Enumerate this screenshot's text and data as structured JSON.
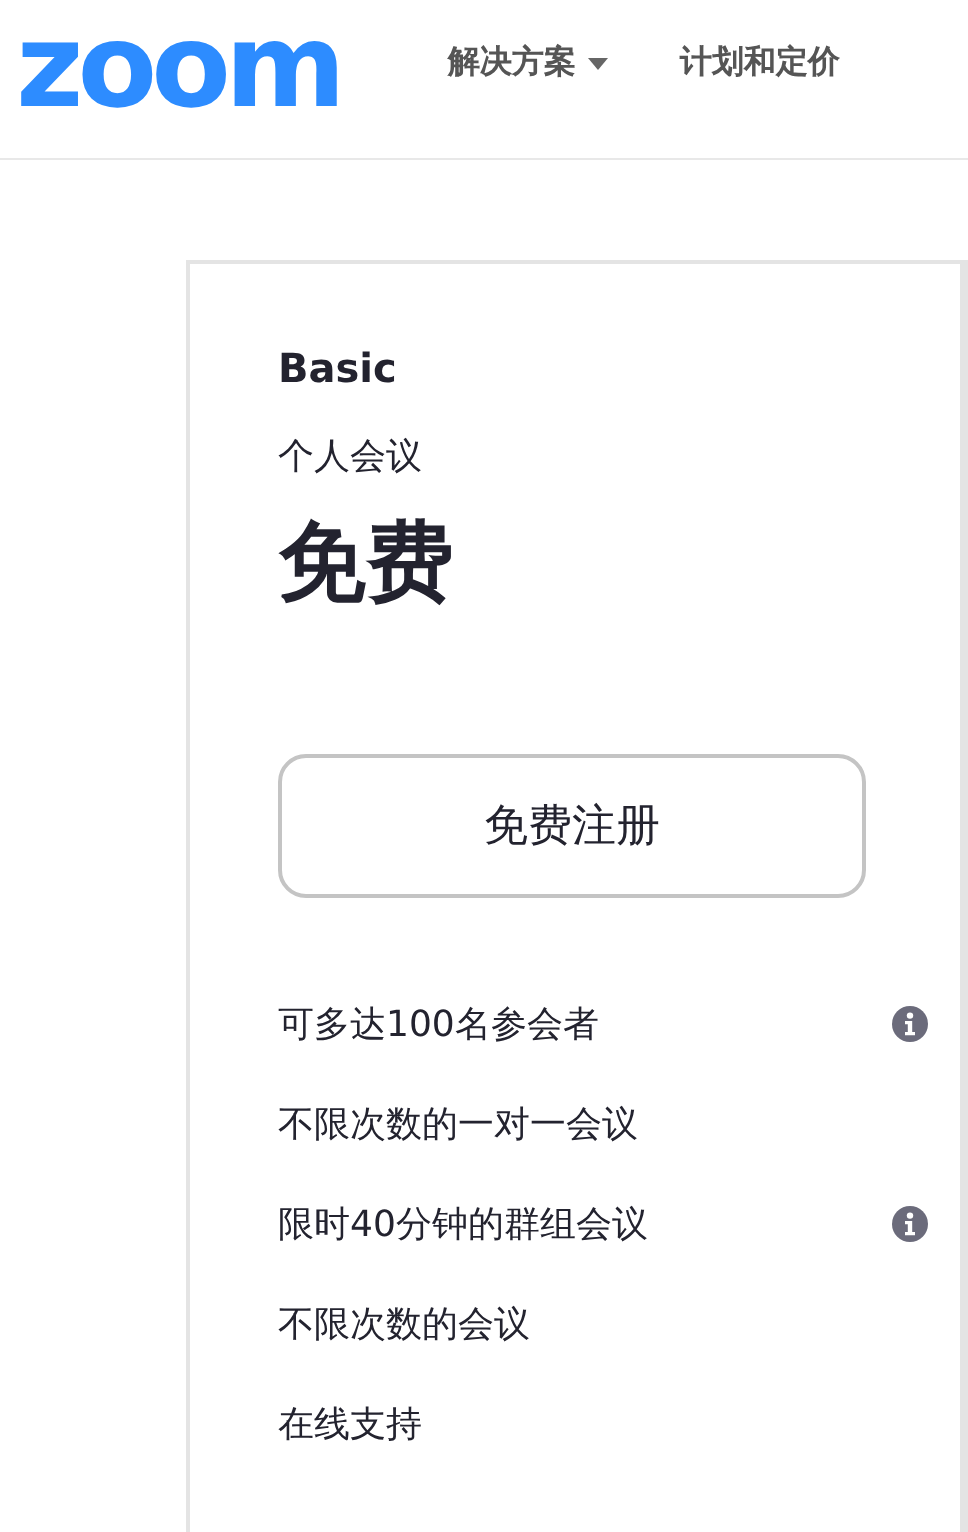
{
  "header": {
    "logo": "zoom",
    "nav": [
      {
        "label": "解决方案",
        "has_menu": true
      },
      {
        "label": "计划和定价",
        "has_menu": false
      }
    ]
  },
  "plan": {
    "name": "Basic",
    "subtitle": "个人会议",
    "price": "免费",
    "button": "免费注册",
    "features": [
      {
        "text": "可多达100名参会者",
        "info": true
      },
      {
        "text": "不限次数的一对一会议",
        "info": false
      },
      {
        "text": "限时40分钟的群组会议",
        "info": true
      },
      {
        "text": "不限次数的会议",
        "info": false
      },
      {
        "text": "在线支持",
        "info": false
      }
    ]
  }
}
